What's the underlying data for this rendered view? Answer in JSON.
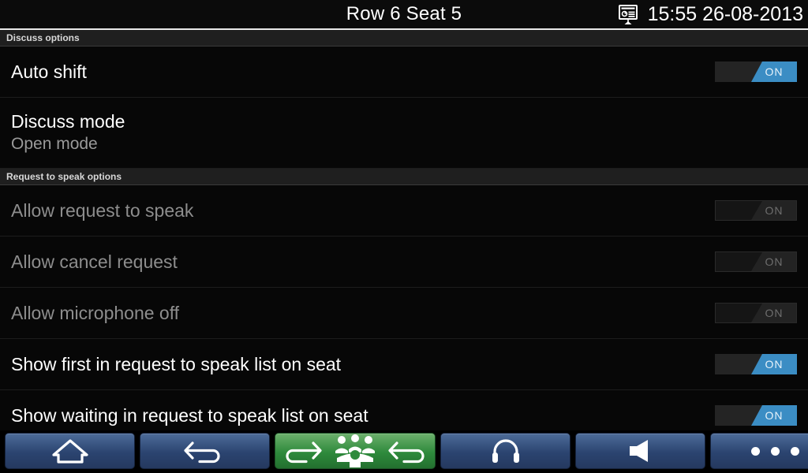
{
  "titlebar": {
    "title": "Row 6 Seat 5",
    "clock": "15:55 26-08-2013",
    "presentation_icon": "presentation-screen-icon"
  },
  "sections": [
    {
      "header": "Discuss options",
      "rows": [
        {
          "primary": "Auto shift",
          "secondary": "",
          "toggle": {
            "state": "ON",
            "label": "ON",
            "enabled": true
          }
        },
        {
          "primary": "Discuss mode",
          "secondary": "Open mode",
          "toggle": null
        }
      ]
    },
    {
      "header": "Request to speak options",
      "rows": [
        {
          "primary": "Allow request to speak",
          "secondary": "",
          "toggle": {
            "state": "ON",
            "label": "ON",
            "enabled": false
          }
        },
        {
          "primary": "Allow cancel request",
          "secondary": "",
          "toggle": {
            "state": "ON",
            "label": "ON",
            "enabled": false
          }
        },
        {
          "primary": "Allow microphone off",
          "secondary": "",
          "toggle": {
            "state": "ON",
            "label": "ON",
            "enabled": false
          }
        },
        {
          "primary": "Show first in request to speak list on seat",
          "secondary": "",
          "toggle": {
            "state": "ON",
            "label": "ON",
            "enabled": true
          }
        },
        {
          "primary": "Show waiting in request to speak list on seat",
          "secondary": "",
          "toggle": {
            "state": "ON",
            "label": "ON",
            "enabled": true
          }
        }
      ]
    }
  ],
  "toolbar": {
    "buttons": [
      {
        "icon": "home-icon",
        "label": "",
        "style": "blue"
      },
      {
        "icon": "back-arrow-icon",
        "label": "",
        "style": "blue"
      },
      {
        "icon": "discuss-group-icon",
        "label": "",
        "style": "green"
      },
      {
        "icon": "headphones-icon",
        "label": "",
        "style": "blue"
      },
      {
        "icon": "speaker-icon",
        "label": "",
        "style": "blue"
      },
      {
        "icon": "overflow-menu-icon",
        "label": "",
        "style": "blue"
      }
    ]
  },
  "colors": {
    "accent_blue": "#3b8dc4",
    "button_blue": "#2b4470",
    "button_green": "#2e8a3c",
    "background": "#070707",
    "section_band": "#1f1f1f",
    "text_primary": "#ffffff",
    "text_secondary": "#9a9a9a",
    "text_disabled": "#8d8d8d"
  }
}
